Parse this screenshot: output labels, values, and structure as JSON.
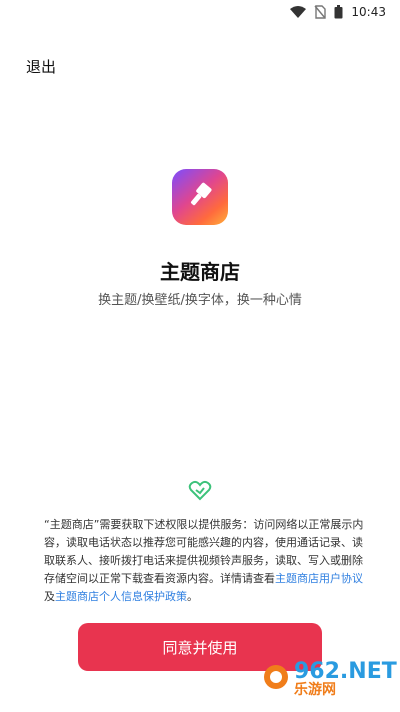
{
  "status_bar": {
    "time": "10:43",
    "icons": [
      "wifi-icon",
      "no-sim-icon",
      "battery-icon"
    ]
  },
  "header": {
    "exit_label": "退出"
  },
  "app": {
    "icon": "brush-icon",
    "title": "主题商店",
    "subtitle": "换主题/换壁纸/换字体，换一种心情"
  },
  "privacy": {
    "icon": "shield-heart-icon",
    "text_before": "“主题商店”需要获取下述权限以提供服务：访问网络以正常展示内容，读取电话状态以推荐您可能感兴趣的内容，使用通话记录、读取联系人、接听拨打电话来提供视频铃声服务，读取、写入或删除存储空间以正常下载查看资源内容。详情请查看",
    "link_user_agreement": "主题商店用户协议",
    "text_and": "及",
    "link_privacy_policy": "主题商店个人信息保护政策",
    "text_end": "。"
  },
  "actions": {
    "agree_label": "同意并使用"
  },
  "watermark": {
    "logo_text": "962.NET",
    "site_text": "乐游网"
  },
  "colors": {
    "primary_button": "#e8344f",
    "link": "#2f7fe0",
    "shield": "#3cc27a"
  }
}
